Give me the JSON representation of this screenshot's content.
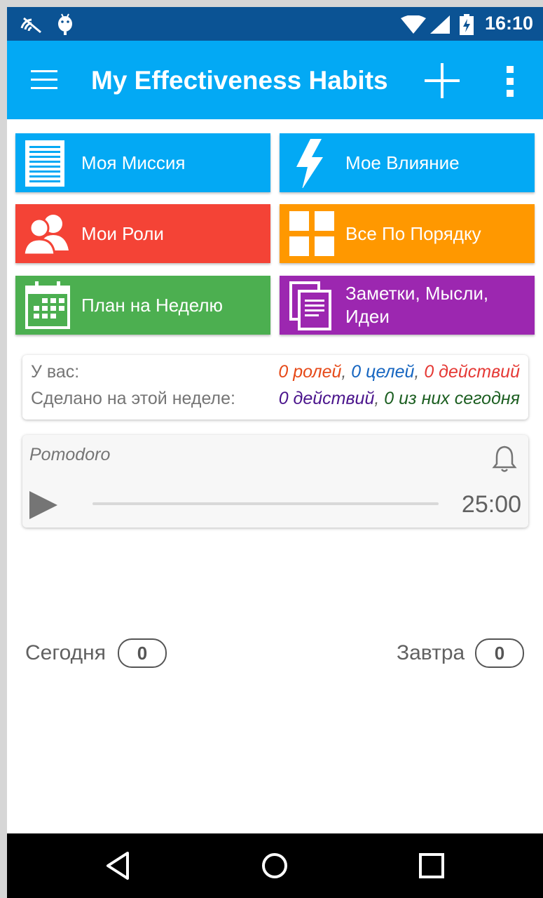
{
  "status_bar": {
    "time": "16:10",
    "icons": [
      "wireless-signal-icon",
      "android-debug-icon",
      "wifi-icon",
      "cell-signal-icon",
      "battery-charging-icon"
    ]
  },
  "app_bar": {
    "title": "My Effectiveness Habits",
    "icons": [
      "menu-icon",
      "add-icon",
      "overflow-menu-icon"
    ]
  },
  "tiles": [
    {
      "label": "Моя Миссия",
      "icon": "document-lines-icon",
      "color": "#03a9f4"
    },
    {
      "label": "Мое Влияние",
      "icon": "lightning-icon",
      "color": "#03a9f4"
    },
    {
      "label": "Мои Роли",
      "icon": "people-icon",
      "color": "#f44336"
    },
    {
      "label": "Все По Порядку",
      "icon": "grid-squares-icon",
      "color": "#ff9800"
    },
    {
      "label": "План на Неделю",
      "icon": "calendar-icon",
      "color": "#4caf50"
    },
    {
      "label": "Заметки, Мысли, Идеи",
      "icon": "notes-icon",
      "color": "#9c27b0"
    }
  ],
  "stats": {
    "have_label": "У вас:",
    "roles": "0 ролей",
    "goals": "0 целей",
    "actions": "0 действий",
    "done_label": "Сделано на этой неделе:",
    "done_actions": "0 действий",
    "done_today": "0 из них сегодня",
    "sep": ", ",
    "colors": {
      "roles": "#e64a19",
      "goals": "#1565c0",
      "actions": "#e53935",
      "done_actions": "#4a148c",
      "done_today": "#1b5e20"
    }
  },
  "pomodoro": {
    "title": "Pomodoro",
    "time": "25:00",
    "progress": 0,
    "icons": [
      "bell-icon",
      "play-icon"
    ]
  },
  "counters": {
    "today_label": "Сегодня",
    "today_count": "0",
    "tomorrow_label": "Завтра",
    "tomorrow_count": "0"
  },
  "nav_bar": {
    "icons": [
      "back-icon",
      "home-icon",
      "recents-icon"
    ]
  }
}
